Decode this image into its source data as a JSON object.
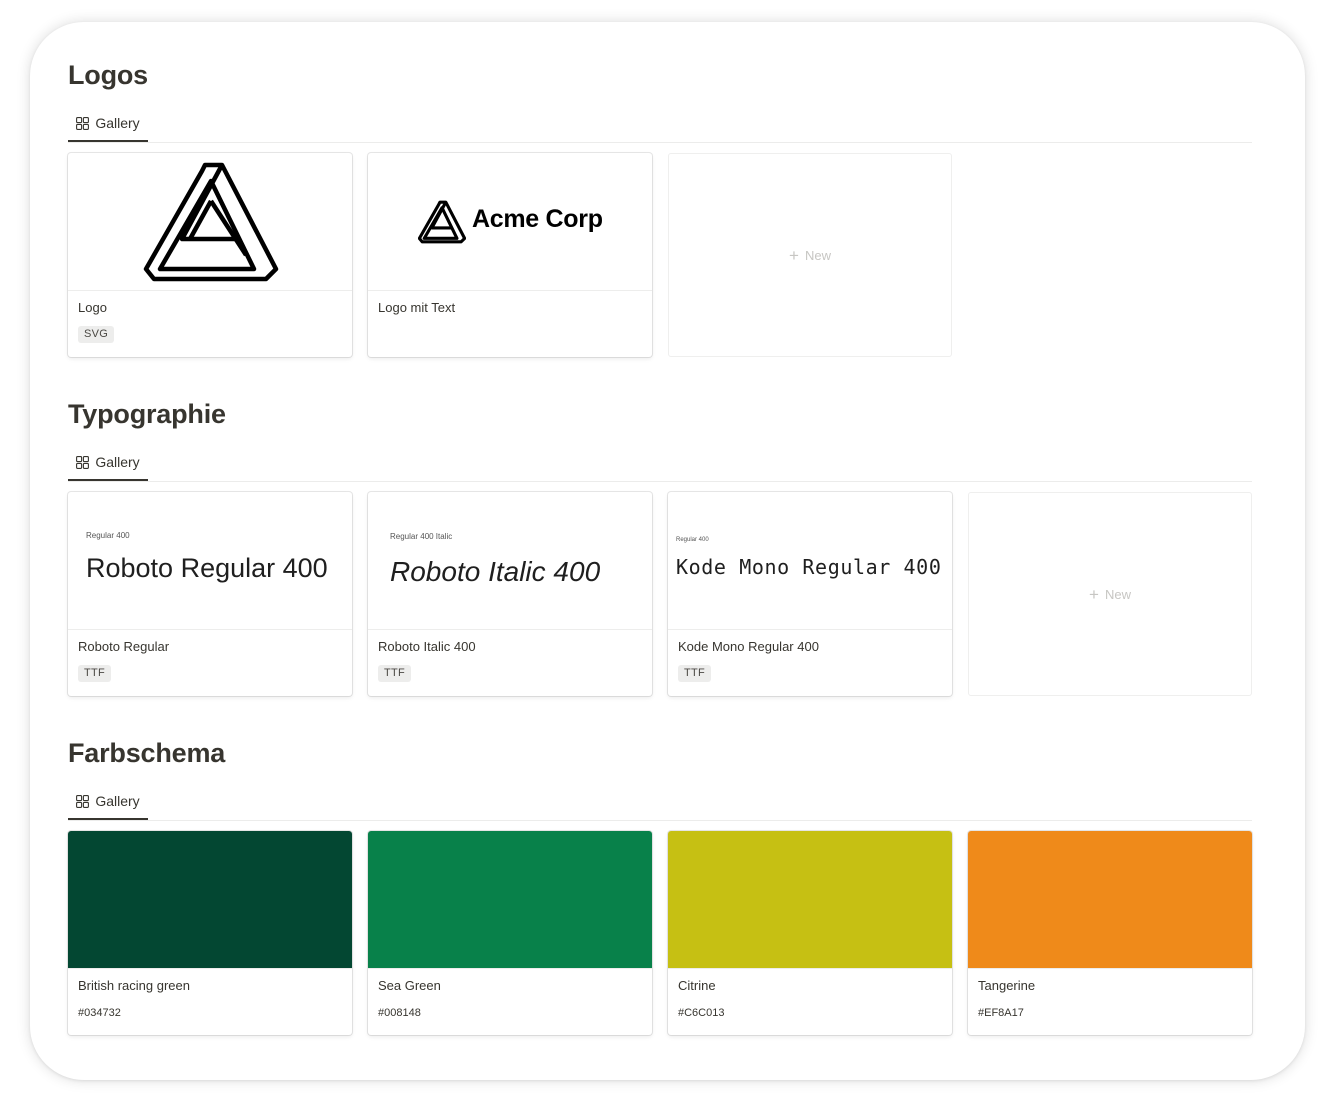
{
  "sections": {
    "logos": {
      "title": "Logos",
      "tab_label": "Gallery",
      "cards": [
        {
          "title": "Logo",
          "tag": "SVG"
        },
        {
          "title": "Logo mit Text",
          "cover_text": "Acme Corp"
        }
      ],
      "new_label": "New"
    },
    "typography": {
      "title": "Typographie",
      "tab_label": "Gallery",
      "cards": [
        {
          "preview_small": "Regular 400",
          "preview_big": "Roboto Regular 400",
          "title": "Roboto Regular",
          "tag": "TTF"
        },
        {
          "preview_small": "Regular 400 Italic",
          "preview_big": "Roboto Italic 400",
          "title": "Roboto Italic 400",
          "tag": "TTF"
        },
        {
          "preview_small": "Regular 400",
          "preview_big": "Kode Mono Regular 400",
          "title": "Kode Mono Regular 400",
          "tag": "TTF"
        }
      ],
      "new_label": "New"
    },
    "colors": {
      "title": "Farbschema",
      "tab_label": "Gallery",
      "cards": [
        {
          "title": "British racing green",
          "hex": "#034732",
          "color": "#034732"
        },
        {
          "title": "Sea Green",
          "hex": "#008148",
          "color": "#08814a"
        },
        {
          "title": "Citrine",
          "hex": "#C6C013",
          "color": "#c6c013"
        },
        {
          "title": "Tangerine",
          "hex": "#EF8A17",
          "color": "#ef8a1a"
        }
      ]
    }
  },
  "icons": {
    "tab": "gallery-grid-icon",
    "logo": "impossible-triangle-icon",
    "new": "plus-icon"
  }
}
